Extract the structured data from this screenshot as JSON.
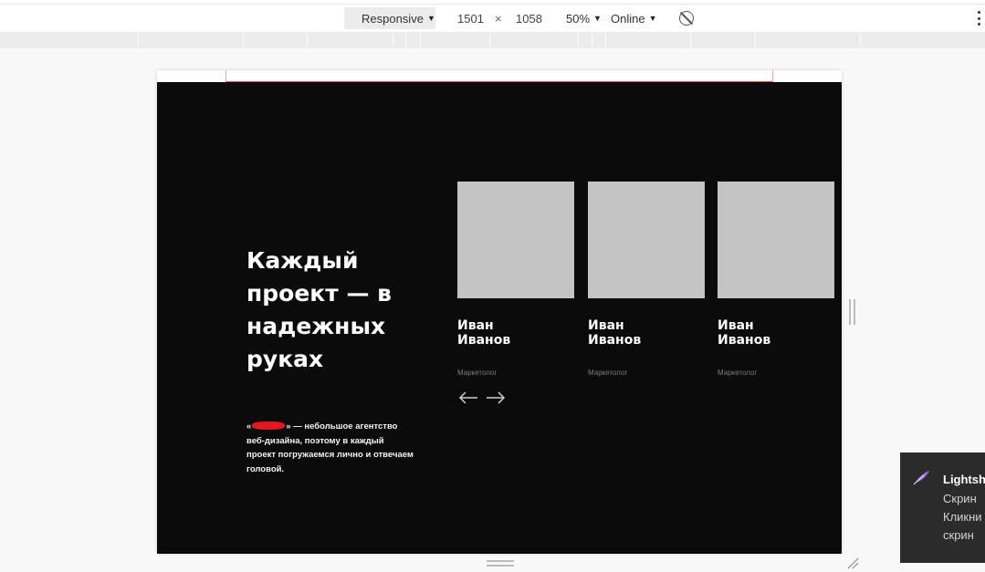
{
  "devtools": {
    "device_mode": "Responsive",
    "width": "1501",
    "times": "×",
    "height": "1058",
    "zoom": "50%",
    "throttling": "Online",
    "icons": [
      "dropdown-triangle-icon",
      "rotate-icon",
      "more-options-icon"
    ]
  },
  "page": {
    "hero": {
      "title": "Каждый\nпроект — в\nнадежных\nруках",
      "description": "— небольшое агентство веб-дизайна, поэтому в каждый проект погружаемся лично и отвечаем головой.",
      "brand_quote_open": "«",
      "brand_quote_close": "»"
    },
    "team": [
      {
        "name": "Иван\nИванов",
        "role": "Маркетолог"
      },
      {
        "name": "Иван\nИванов",
        "role": "Маркетолог"
      },
      {
        "name": "Иван\nИванов",
        "role": "Маркетолог"
      }
    ],
    "colors": {
      "background": "#0b0b0b",
      "photo_placeholder": "#c4c4c4",
      "text": "#ffffff",
      "muted": "#7a7a7a"
    }
  },
  "toast": {
    "title": "Lightsh",
    "line1": "Скрин",
    "line2": "Кликни",
    "line3": "скрин",
    "icon": "feather-icon",
    "accent": "#9b6ddb"
  }
}
